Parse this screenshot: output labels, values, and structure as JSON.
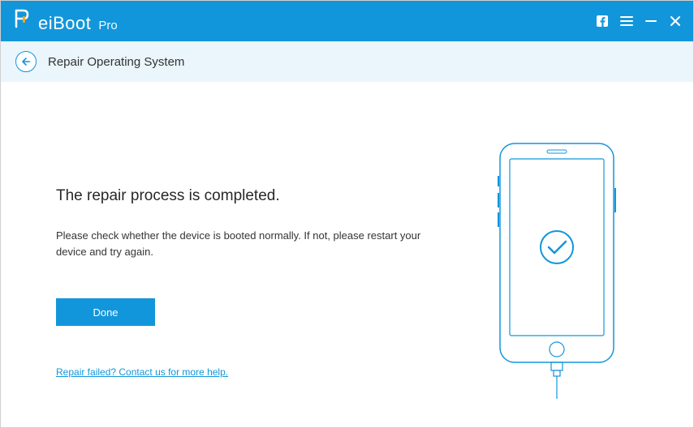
{
  "brand": {
    "name": "eiBoot",
    "suffix": "Pro"
  },
  "page": {
    "title": "Repair Operating System"
  },
  "main": {
    "heading": "The repair process is completed.",
    "description": "Please check whether the device is booted normally. If not, please restart your device and try again.",
    "done_label": "Done",
    "help_link": "Repair failed? Contact us for more help."
  },
  "icons": {
    "back": "back-arrow",
    "facebook": "facebook-icon",
    "menu": "menu-icon",
    "minimize": "minimize-icon",
    "close": "close-icon",
    "check": "check-icon"
  },
  "colors": {
    "primary": "#1296db",
    "subheader_bg": "#eaf5fc"
  }
}
